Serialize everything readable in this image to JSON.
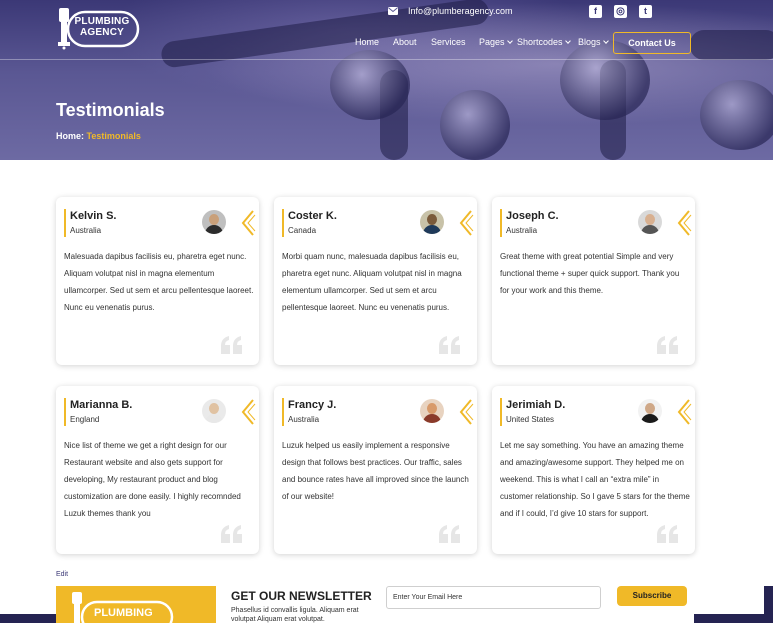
{
  "header": {
    "logo_text_1": "PLUMBING",
    "logo_text_2": "AGENCY",
    "email": "Info@plumberagency.com",
    "social": [
      {
        "icon": "facebook-icon",
        "glyph": "f"
      },
      {
        "icon": "instagram-icon",
        "glyph": "◎"
      },
      {
        "icon": "twitter-icon",
        "glyph": "t"
      }
    ],
    "nav": {
      "home": "Home",
      "about": "About",
      "services": "Services",
      "pages": "Pages",
      "shortcodes": "Shortcodes",
      "blogs": "Blogs"
    },
    "contact_label": "Contact Us"
  },
  "hero": {
    "title": "Testimonials",
    "breadcrumb_home": "Home",
    "breadcrumb_sep": ":",
    "breadcrumb_current": "Testimonials"
  },
  "testimonials": [
    {
      "name": "Kelvin S.",
      "country": "Australia",
      "text": "Malesuada dapibus facilisis eu, pharetra eget nunc. Aliquam volutpat nisl in magna elementum ullamcorper. Sed ut sem et arcu pellentesque laoreet. Nunc eu venenatis purus."
    },
    {
      "name": "Coster K.",
      "country": "Canada",
      "text": "Morbi quam nunc, malesuada dapibus facilisis eu, pharetra eget nunc. Aliquam volutpat nisl in magna elementum ullamcorper. Sed ut sem et arcu pellentesque laoreet. Nunc eu venenatis purus."
    },
    {
      "name": "Joseph C.",
      "country": "Australia",
      "text": "Great theme with great potential Simple and very functional theme + super quick support. Thank you for your work and this theme."
    },
    {
      "name": "Marianna B.",
      "country": "England",
      "text": "Nice list of theme we get a right design for our Restaurant website and also gets support for developing, My restaurant product and blog customization are done easily. I highly recomnded Luzuk themes thank you"
    },
    {
      "name": "Francy J.",
      "country": "Australia",
      "text": "Luzuk helped us easily implement a responsive design that follows best practices. Our traffic, sales and bounce rates have all improved since the launch of our website!"
    },
    {
      "name": "Jerimiah D.",
      "country": "United States",
      "text": "Let me say something. You have an amazing theme and amazing/awesome support. They helped me on weekend. This is what I call an “extra mile” in customer relationship. So I gave 5 stars for the theme and if I could, I’d give 10 stars for support."
    }
  ],
  "edit_label": "Edit",
  "newsletter": {
    "logo_text": "PLUMBING",
    "title": "GET OUR NEWSLETTER",
    "subtitle": "Phasellus id convallis ligula. Aliquam erat volutpat Aliquam erat volutpat.",
    "placeholder": "Enter Your Email Here",
    "button": "Subscribe"
  },
  "colors": {
    "accent": "#f0b928",
    "hero_dark": "#3b3876",
    "footer": "#252352"
  }
}
